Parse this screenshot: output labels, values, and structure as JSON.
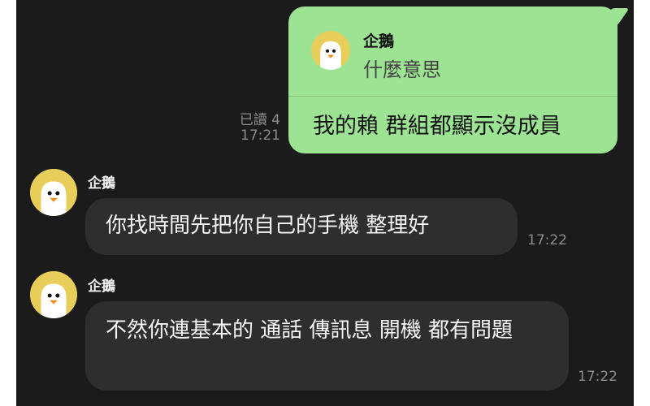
{
  "outgoing": {
    "reply_quote": {
      "sender": "企鵝",
      "text": "什麼意思"
    },
    "text": "我的賴 群組都顯示沒成員",
    "read_status": "已讀 4",
    "time": "17:21"
  },
  "incoming": [
    {
      "sender": "企鵝",
      "avatar": "penguin-icon",
      "text": "你找時間先把你自己的手機 整理好",
      "time": "17:22"
    },
    {
      "sender": "企鵝",
      "avatar": "penguin-icon",
      "text": "不然你連基本的 通話 傳訊息 開機 都有問題",
      "time": "17:22"
    }
  ],
  "colors": {
    "chat_background": "#1b1b1b",
    "outgoing_bubble": "#9de394",
    "incoming_bubble": "#2e2e2e",
    "avatar_background": "#e7ce5a"
  }
}
